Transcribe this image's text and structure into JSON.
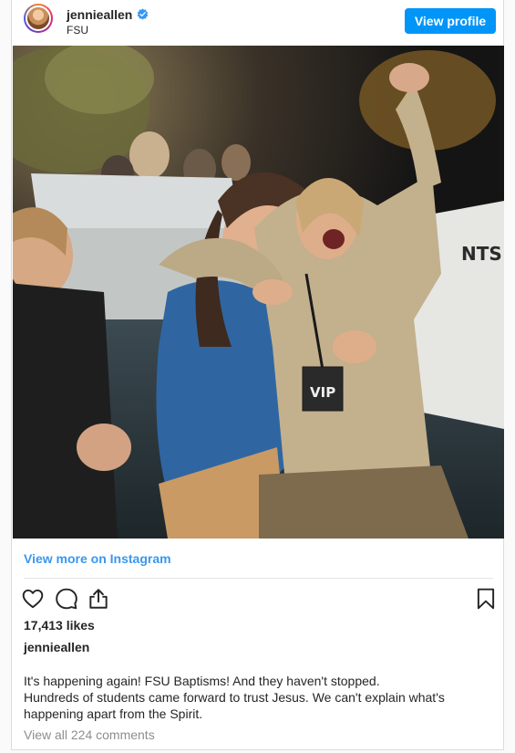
{
  "header": {
    "username": "jennieallen",
    "location": "FSU",
    "view_profile_label": "View profile"
  },
  "photo": {
    "vip_badge_text": "VIP",
    "shirt_text": "NTS"
  },
  "view_more_label": "View more on Instagram",
  "likes": "17,413 likes",
  "caption": {
    "username": "jennieallen",
    "line1": "It's happening again! FSU Baptisms! And they haven't stopped.",
    "line2": "Hundreds of students came forward to trust Jesus. We can't explain what's",
    "line3": "happening apart from the Spirit."
  },
  "comments_label": "View all 224 comments",
  "icons": {
    "verified": "verified-badge-icon",
    "like": "heart-icon",
    "comment": "comment-icon",
    "share": "share-icon",
    "save": "bookmark-icon"
  },
  "colors": {
    "accent": "#0095f6",
    "link": "#3897f0",
    "muted": "#8e8e8e"
  }
}
